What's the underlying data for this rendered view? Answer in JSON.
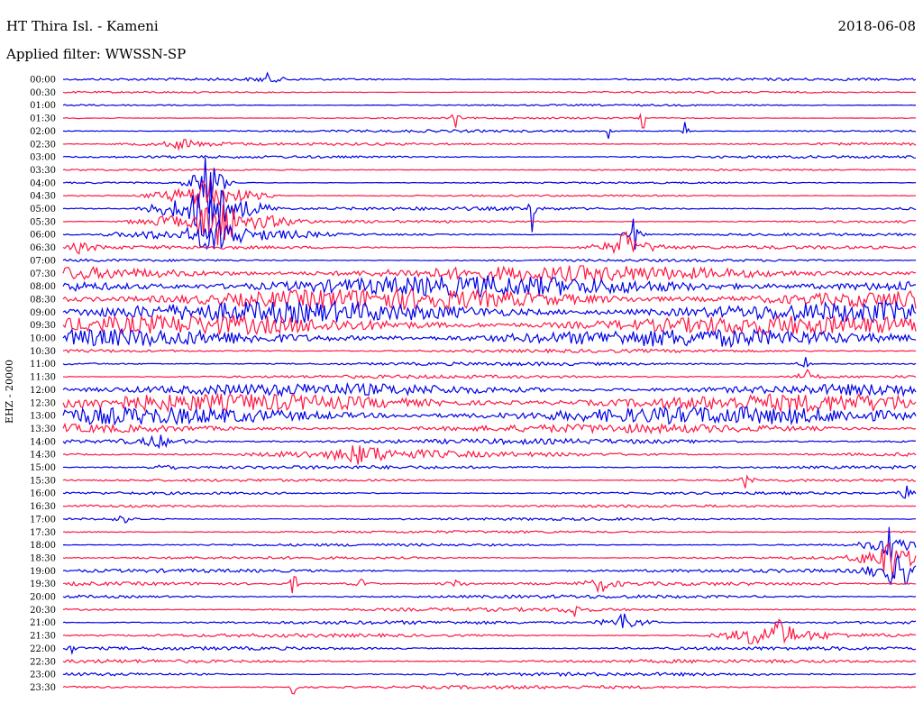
{
  "header": {
    "station": "HT Thira Isl. - Kameni",
    "date": "2018-06-08",
    "filter": "Applied filter: WWSSN-SP"
  },
  "chart_data": {
    "type": "line",
    "ylabel": "EHZ - 20000",
    "row_labels": [
      "00:00",
      "00:30",
      "01:00",
      "01:30",
      "02:00",
      "02:30",
      "03:00",
      "03:30",
      "04:00",
      "04:30",
      "05:00",
      "05:30",
      "06:00",
      "06:30",
      "07:00",
      "07:30",
      "08:00",
      "08:30",
      "09:00",
      "09:30",
      "10:00",
      "10:30",
      "11:00",
      "11:30",
      "12:00",
      "12:30",
      "13:00",
      "13:30",
      "14:00",
      "14:30",
      "15:00",
      "15:30",
      "16:00",
      "16:30",
      "17:00",
      "17:30",
      "18:00",
      "18:30",
      "19:00",
      "19:30",
      "20:00",
      "20:30",
      "21:00",
      "21:30",
      "22:00",
      "22:30",
      "23:00",
      "23:30"
    ],
    "colors": [
      "#0000e6",
      "#ff1744"
    ],
    "noise_level": [
      1.5,
      1,
      1,
      1,
      1.5,
      1.5,
      1.5,
      1,
      1,
      1,
      2,
      1.5,
      1.5,
      2,
      1.5,
      9,
      12,
      12,
      12,
      11,
      10,
      2,
      2,
      2,
      7,
      10,
      10,
      5,
      3,
      3,
      2,
      1.5,
      1.5,
      1.5,
      1.5,
      1.5,
      1.5,
      1.5,
      2,
      2,
      2,
      2,
      2,
      2,
      2,
      2,
      2,
      2
    ],
    "events": [
      {
        "row": 0,
        "x": 0.24,
        "amp": 6,
        "width": 0.01
      },
      {
        "row": 3,
        "x": 0.46,
        "amp": 28,
        "width": 0.002
      },
      {
        "row": 3,
        "x": 0.68,
        "amp": 40,
        "width": 0.002
      },
      {
        "row": 4,
        "x": 0.64,
        "amp": 18,
        "width": 0.002
      },
      {
        "row": 4,
        "x": 0.73,
        "amp": 18,
        "width": 0.002
      },
      {
        "row": 5,
        "x": 0.14,
        "amp": 6,
        "width": 0.03
      },
      {
        "row": 8,
        "x": 0.17,
        "amp": 40,
        "width": 0.012
      },
      {
        "row": 9,
        "x": 0.17,
        "amp": 30,
        "width": 0.03
      },
      {
        "row": 10,
        "x": 0.17,
        "amp": 45,
        "width": 0.03
      },
      {
        "row": 11,
        "x": 0.18,
        "amp": 30,
        "width": 0.04
      },
      {
        "row": 12,
        "x": 0.18,
        "amp": 20,
        "width": 0.05
      },
      {
        "row": 13,
        "x": 0.02,
        "amp": 6,
        "width": 0.015
      },
      {
        "row": 13,
        "x": 0.66,
        "amp": 18,
        "width": 0.02
      },
      {
        "row": 12,
        "x": 0.67,
        "amp": 22,
        "width": 0.006
      },
      {
        "row": 10,
        "x": 0.55,
        "amp": 50,
        "width": 0.002
      },
      {
        "row": 22,
        "x": 0.87,
        "amp": 15,
        "width": 0.004
      },
      {
        "row": 23,
        "x": 0.87,
        "amp": 10,
        "width": 0.01
      },
      {
        "row": 28,
        "x": 0.11,
        "amp": 8,
        "width": 0.025
      },
      {
        "row": 29,
        "x": 0.35,
        "amp": 10,
        "width": 0.05
      },
      {
        "row": 30,
        "x": 0.12,
        "amp": 6,
        "width": 0.01
      },
      {
        "row": 31,
        "x": 0.8,
        "amp": 10,
        "width": 0.005
      },
      {
        "row": 32,
        "x": 0.99,
        "amp": 8,
        "width": 0.01
      },
      {
        "row": 34,
        "x": 0.07,
        "amp": 5,
        "width": 0.01
      },
      {
        "row": 36,
        "x": 0.97,
        "amp": 25,
        "width": 0.015
      },
      {
        "row": 37,
        "x": 0.97,
        "amp": 30,
        "width": 0.02
      },
      {
        "row": 38,
        "x": 0.98,
        "amp": 25,
        "width": 0.02
      },
      {
        "row": 39,
        "x": 0.63,
        "amp": 10,
        "width": 0.012
      },
      {
        "row": 39,
        "x": 0.46,
        "amp": 6,
        "width": 0.01
      },
      {
        "row": 39,
        "x": 0.35,
        "amp": 5,
        "width": 0.01
      },
      {
        "row": 39,
        "x": 0.27,
        "amp": 45,
        "width": 0.002
      },
      {
        "row": 41,
        "x": 0.6,
        "amp": 8,
        "width": 0.008
      },
      {
        "row": 42,
        "x": 0.66,
        "amp": 15,
        "width": 0.015
      },
      {
        "row": 43,
        "x": 0.84,
        "amp": 16,
        "width": 0.03
      },
      {
        "row": 43,
        "x": 0.81,
        "amp": 8,
        "width": 0.02
      },
      {
        "row": 44,
        "x": 0.01,
        "amp": 5,
        "width": 0.005
      },
      {
        "row": 47,
        "x": 0.27,
        "amp": 20,
        "width": 0.002
      }
    ]
  }
}
